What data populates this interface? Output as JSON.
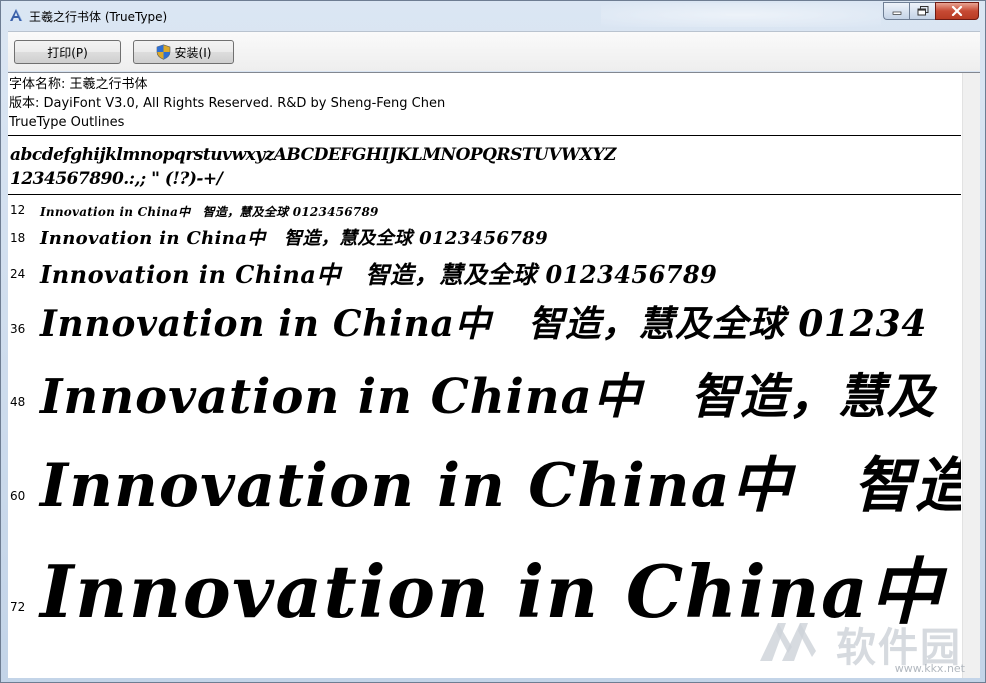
{
  "window": {
    "title": "王羲之行书体 (TrueType)"
  },
  "toolbar": {
    "print_label": "打印(P)",
    "install_label": "安装(I)"
  },
  "font_info": {
    "name_line": "字体名称: 王羲之行书体",
    "version_line": "版本: DayiFont V3.0, All Rights Reserved. R&D by Sheng-Feng Chen",
    "type_line": "TrueType Outlines"
  },
  "charset": {
    "line1": "abcdefghijklmnopqrstuvwxyzABCDEFGHIJKLMNOPQRSTUVWXYZ",
    "line2": "1234567890.:,; \" (!?)-+/"
  },
  "samples": [
    {
      "size": "12",
      "text": "Innovation in China中　智造，慧及全球 0123456789"
    },
    {
      "size": "18",
      "text": "Innovation in China中　智造，慧及全球 0123456789"
    },
    {
      "size": "24",
      "text": "Innovation in China中　智造，慧及全球 0123456789"
    },
    {
      "size": "36",
      "text": "Innovation in China中　智造，慧及全球 01234"
    },
    {
      "size": "48",
      "text": "Innovation in China中　智造，慧及"
    },
    {
      "size": "60",
      "text": "Innovation in China中　智造"
    },
    {
      "size": "72",
      "text": "Innovation in China中"
    }
  ],
  "watermark": {
    "text": "软件园",
    "url": "www.kkx.net"
  }
}
